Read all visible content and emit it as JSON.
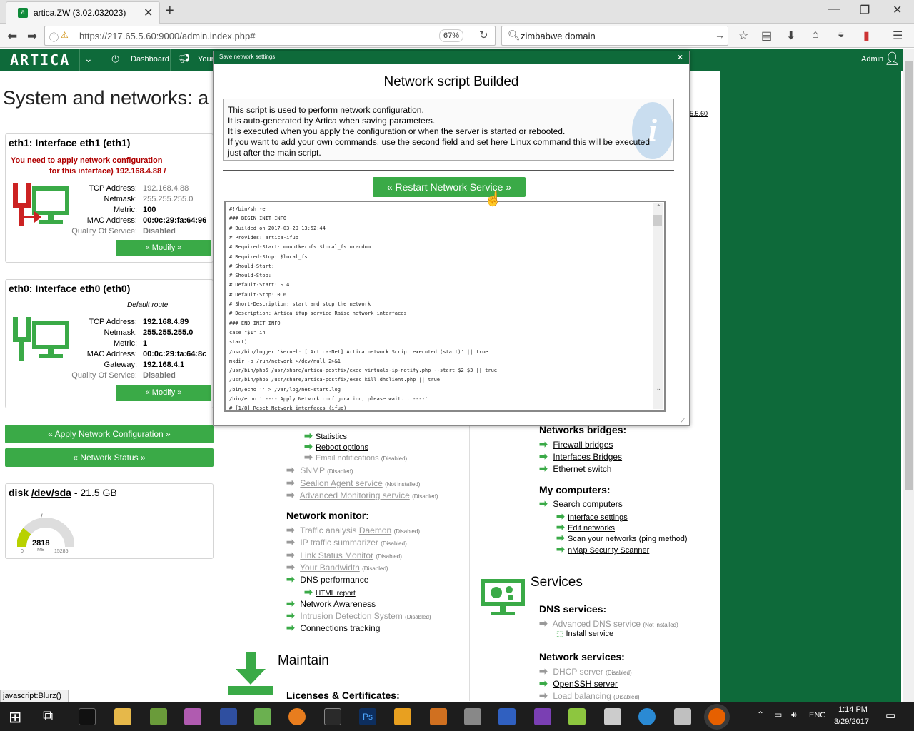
{
  "browser": {
    "tab_title": "artica.ZW (3.02.032023)",
    "url": "https://217.65.5.60:9000/admin.index.php#",
    "zoom": "67%",
    "search_value": "zimbabwe domain",
    "status_url": "javascript:Blurz()"
  },
  "topbar": {
    "logo": "ARTICA",
    "dashboard": "Dashboard",
    "your": "Your",
    "admin": "Admin"
  },
  "page": {
    "title": "System and networks: a",
    "ip_fragment": "5.5.60"
  },
  "eth1": {
    "title": "eth1: Interface eth1 (eth1)",
    "warn1": "You need to apply network configuration",
    "warn2": "for this interface) 192.168.4.88 /",
    "tcp_label": "TCP Address:",
    "tcp": "192.168.4.88",
    "mask_label": "Netmask:",
    "mask": "255.255.255.0",
    "metric_label": "Metric:",
    "metric": "100",
    "mac_label": "MAC Address:",
    "mac": "00:0c:29:fa:64:96",
    "qos_label": "Quality Of Service:",
    "qos": "Disabled",
    "modify": "« Modify »"
  },
  "eth0": {
    "title": "eth0: Interface eth0 (eth0)",
    "route": "Default route",
    "tcp_label": "TCP Address:",
    "tcp": "192.168.4.89",
    "mask_label": "Netmask:",
    "mask": "255.255.255.0",
    "metric_label": "Metric:",
    "metric": "1",
    "mac_label": "MAC Address:",
    "mac": "00:0c:29:fa:64:8c",
    "gw_label": "Gateway:",
    "gw": "192.168.4.1",
    "qos_label": "Quality Of Service:",
    "qos": "Disabled",
    "modify": "« Modify »"
  },
  "buttons": {
    "apply": "« Apply Network Configuration »",
    "status": "« Network Status »"
  },
  "disk": {
    "name": "disk ",
    "dev": "/dev/sda",
    "size": " - 21.5 GB",
    "value": "2818",
    "unit": "MB",
    "min": "0",
    "max": "15285",
    "mark": "/"
  },
  "middle": {
    "statistics": "Statistics",
    "reboot": "Reboot options",
    "email": "Email notifications",
    "email_tag": "(Disabled)",
    "snmp": "SNMP",
    "snmp_tag": "(Disabled)",
    "sealion": "Sealion Agent service",
    "sealion_tag": "(Not installed)",
    "advmon": "Advanced Monitoring service",
    "advmon_tag": "(Disabled)",
    "netmon": "Network monitor:",
    "traffic": "Traffic analysis ",
    "traffic_link": "Daemon",
    "traffic_tag": "(Disabled)",
    "iptraffic": "IP traffic summarizer",
    "iptraffic_tag": "(Disabled)",
    "linkstatus": "Link Status Monitor",
    "linkstatus_tag": "(Disabled)",
    "bandwidth": "Your Bandwidth",
    "bandwidth_tag": "(Disabled)",
    "dnsperf": "DNS performance",
    "htmlreport": "HTML report",
    "awareness": "Network Awareness",
    "ids": "Intrusion Detection System",
    "ids_tag": "(Disabled)",
    "conntrack": "Connections tracking",
    "maintain": "Maintain",
    "licenses": "Licenses & Certificates:"
  },
  "right": {
    "bridges": "Networks bridges:",
    "fwbridges": "Firewall bridges",
    "ifbridges": "Interfaces Bridges",
    "ethswitch": "Ethernet switch",
    "computers": "My computers:",
    "searchcomp": "Search computers",
    "ifsettings": "Interface settings",
    "editnet": "Edit networks",
    "scan": "Scan your networks (ping method)",
    "nmap": "nMap Security Scanner",
    "services": "Services",
    "dnsservices": "DNS services:",
    "advdns": "Advanced DNS service",
    "advdns_tag": "(Not installed)",
    "install": "Install service",
    "netservices": "Network services:",
    "dhcp": "DHCP server",
    "dhcp_tag": "(Disabled)",
    "openssh": "OpenSSH server",
    "lb": "Load balancing",
    "lb_tag": "(Disabled)"
  },
  "modal": {
    "header": "Save network settings",
    "close": "×",
    "title": "Network script Builded",
    "info1": "This script is used to perform network configuration.",
    "info2": "It is auto-generated by Artica when saving parameters.",
    "info3": "It is executed when you apply the configuration or when the server is started or rebooted.",
    "info4": "If you want to add your own commands, use the second field and set here Linux command this will be executed just after the main script.",
    "restart": "« Restart Network Service »",
    "code": [
      "#!/bin/sh -e",
      "### BEGIN INIT INFO",
      "# Builded on 2017-03-29 13:52:44",
      "# Provides:          artica-ifup",
      "# Required-Start:    mountkernfs $local_fs urandom",
      "# Required-Stop:     $local_fs",
      "# Should-Start:",
      "# Should-Stop:",
      "# Default-Start:     S 4",
      "# Default-Stop:      0 6",
      "# Short-Description: start and stop the network",
      "# Description:       Artica ifup service Raise network interfaces",
      "### END INIT INFO",
      "case \"$1\" in",
      "start)",
      "/usr/bin/logger 'kernel: [  Artica-Net] Artica network Script executed (start)' || true",
      "mkdir -p /run/network >/dev/null 2>&1",
      "/usr/bin/php5 /usr/share/artica-postfix/exec.virtuals-ip-notify.php --start $2 $3 || true",
      "/usr/bin/php5 /usr/share/artica-postfix/exec.kill.dhclient.php || true",
      "/bin/echo '' > /var/log/net-start.log",
      "/bin/echo '  ---- Apply Network configuration, please wait... ----'",
      "# [1/8] Reset Network interfaces (ifup)"
    ]
  },
  "taskbar": {
    "lang": "ENG",
    "time": "1:14 PM",
    "date": "3/29/2017"
  }
}
